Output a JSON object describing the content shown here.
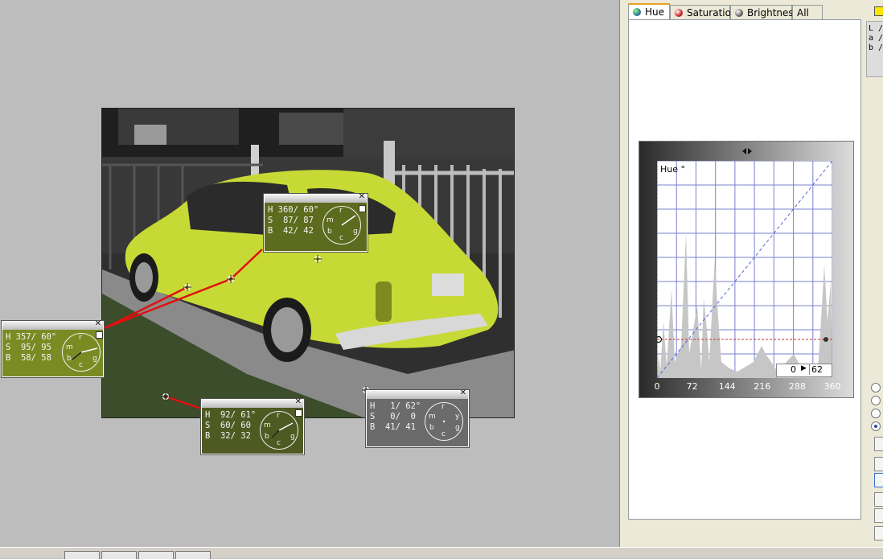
{
  "tabs": [
    {
      "label": "Hue",
      "icon": "hue-ball-icon",
      "active": true
    },
    {
      "label": "Saturation",
      "icon": "saturation-ball-icon",
      "active": false
    },
    {
      "label": "Brightness",
      "icon": "brightness-ball-icon",
      "active": false
    },
    {
      "label": "All",
      "icon": "",
      "active": false
    }
  ],
  "curve": {
    "label": "Hue °",
    "input_value": "0",
    "output_value": "62",
    "x_ticks": [
      "0",
      "72",
      "144",
      "216",
      "288",
      "360"
    ]
  },
  "lab_readout": {
    "l": "L /",
    "a": "a /",
    "b": "b /"
  },
  "probes": [
    {
      "h": "357/ 60°",
      "s": " 95/ 95",
      "b": " 58/ 58",
      "color": "#7a8b24"
    },
    {
      "h": "360/ 60°",
      "s": " 87/ 87",
      "b": " 42/ 42",
      "color": "#5d6b1e"
    },
    {
      "h": " 92/ 61°",
      "s": " 60/ 60",
      "b": " 32/ 32",
      "color": "#4f5a22"
    },
    {
      "h": "  1/ 62°",
      "s": "  0/  0",
      "b": " 41/ 41",
      "color": "#6b6b6b"
    }
  ],
  "probe_labels": {
    "h": "H",
    "s": "S",
    "b": "B"
  },
  "dial_letters": {
    "r": "r",
    "y": "y",
    "g": "g",
    "c": "c",
    "b": "b",
    "m": "m"
  },
  "colors": {
    "car": "#c7d935",
    "tab_accent": "#e8a127",
    "curve_grid": "#7b7fd0",
    "probe_line": "#e01010"
  }
}
